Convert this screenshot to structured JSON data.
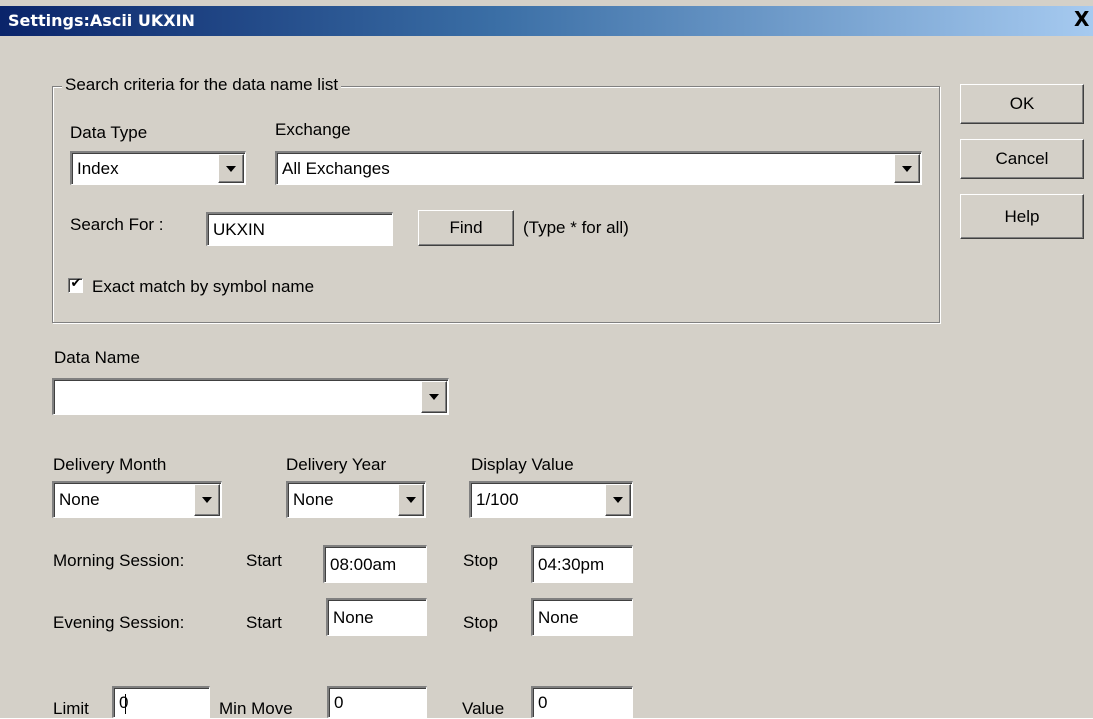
{
  "window": {
    "title": "Settings:Ascii UKXIN",
    "close_glyph": "X"
  },
  "buttons": {
    "ok": "OK",
    "cancel": "Cancel",
    "help": "Help",
    "find": "Find"
  },
  "search": {
    "group_label": "Search criteria for the data name list",
    "data_type_label": "Data Type",
    "data_type_value": "Index",
    "exchange_label": "Exchange",
    "exchange_value": "All Exchanges",
    "search_for_label": "Search For :",
    "search_for_value": "UKXIN",
    "hint": "(Type * for all)",
    "exact_match_label": "Exact match by symbol name",
    "exact_match_checked": true,
    "check_glyph": "✔"
  },
  "data_name": {
    "label": "Data Name",
    "value": ""
  },
  "delivery": {
    "month_label": "Delivery Month",
    "month_value": "None",
    "year_label": "Delivery Year",
    "year_value": "None",
    "display_label": "Display Value",
    "display_value": "1/100"
  },
  "sessions": {
    "morning_label": "Morning Session:",
    "evening_label": "Evening Session:",
    "start_label": "Start",
    "stop_label": "Stop",
    "morning_start": "08:00am",
    "morning_stop": "04:30pm",
    "evening_start": "None",
    "evening_stop": "None"
  },
  "limits": {
    "limit_label": "Limit",
    "limit_value": "0",
    "min_move_label": "Min Move",
    "min_move_value": "0",
    "value_label": "Value",
    "value_value": "0"
  },
  "icons": {
    "dropdown": "chevron-down-icon",
    "close": "close-icon",
    "check": "checkmark-icon"
  }
}
